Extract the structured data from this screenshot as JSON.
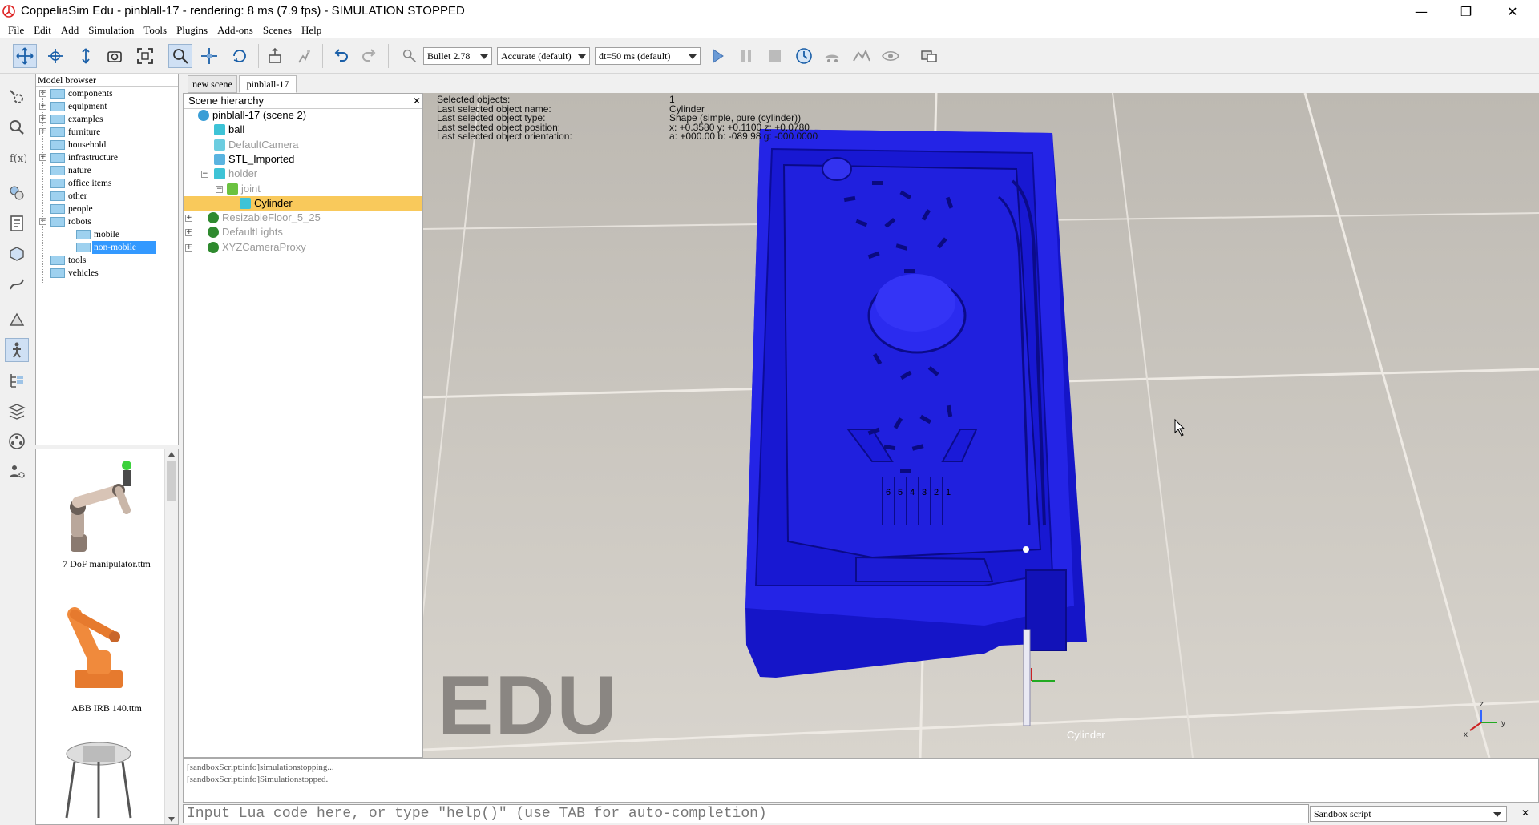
{
  "window": {
    "title": "CoppeliaSim Edu - pinblall-17 - rendering: 8 ms (7.9 fps) - SIMULATION STOPPED",
    "minimize": "—",
    "restore": "❐",
    "close": "✕"
  },
  "menu": [
    "File",
    "Edit",
    "Add",
    "Simulation",
    "Tools",
    "Plugins",
    "Add-ons",
    "Scenes",
    "Help"
  ],
  "toolbar": {
    "engine": "Bullet 2.78",
    "accuracy": "Accurate (default)",
    "timestep": "dt=50 ms (default)"
  },
  "model_browser": {
    "title": "Model browser",
    "items": [
      {
        "label": "components",
        "expandable": true,
        "level": 0
      },
      {
        "label": "equipment",
        "expandable": true,
        "level": 0
      },
      {
        "label": "examples",
        "expandable": true,
        "level": 0
      },
      {
        "label": "furniture",
        "expandable": true,
        "level": 0
      },
      {
        "label": "household",
        "expandable": false,
        "level": 0
      },
      {
        "label": "infrastructure",
        "expandable": true,
        "level": 0
      },
      {
        "label": "nature",
        "expandable": false,
        "level": 0
      },
      {
        "label": "office items",
        "expandable": false,
        "level": 0
      },
      {
        "label": "other",
        "expandable": false,
        "level": 0
      },
      {
        "label": "people",
        "expandable": false,
        "level": 0
      },
      {
        "label": "robots",
        "expandable": true,
        "level": 0
      },
      {
        "label": "mobile",
        "expandable": false,
        "level": 1
      },
      {
        "label": "non-mobile",
        "expandable": false,
        "level": 1,
        "selected": true
      },
      {
        "label": "tools",
        "expandable": false,
        "level": 0
      },
      {
        "label": "vehicles",
        "expandable": false,
        "level": 0
      }
    ],
    "thumbnails": [
      "7 DoF manipulator.ttm",
      "ABB IRB 140.ttm"
    ]
  },
  "scene_tabs": [
    "new scene",
    "pinblall-17"
  ],
  "scene_hierarchy": {
    "title": "Scene hierarchy",
    "items": [
      {
        "label": "pinblall-17 (scene 2)",
        "dim": false,
        "selected": false
      },
      {
        "label": "ball",
        "dim": false,
        "selected": false
      },
      {
        "label": "DefaultCamera",
        "dim": true,
        "selected": false
      },
      {
        "label": "STL_Imported",
        "dim": false,
        "selected": false
      },
      {
        "label": "holder",
        "dim": true,
        "selected": false
      },
      {
        "label": "joint",
        "dim": true,
        "selected": false
      },
      {
        "label": "Cylinder",
        "dim": false,
        "selected": true
      },
      {
        "label": "ResizableFloor_5_25",
        "dim": true,
        "selected": false
      },
      {
        "label": "DefaultLights",
        "dim": true,
        "selected": false
      },
      {
        "label": "XYZCameraProxy",
        "dim": true,
        "selected": false
      }
    ]
  },
  "selection_info": {
    "rows": [
      {
        "label": "Selected objects:",
        "value": "1"
      },
      {
        "label": "Last selected object name:",
        "value": "Cylinder"
      },
      {
        "label": "Last selected object type:",
        "value": "Shape (simple, pure (cylinder))"
      },
      {
        "label": "Last selected object position:",
        "value": "x: +0.3580    y: +0.1100    z: +0.0780"
      },
      {
        "label": "Last selected object orientation:",
        "value": "a: +000.00    b: -089.98    g: -000.0000"
      }
    ]
  },
  "viewport": {
    "watermark": "EDU",
    "object_label": "Cylinder",
    "board_color": "#1f1fe0",
    "axis_x": "x",
    "axis_y": "y",
    "axis_z": "z",
    "lane_numbers": [
      "6",
      "5",
      "4",
      "3",
      "2",
      "1"
    ]
  },
  "console": {
    "lines": [
      "[sandboxScript:info]simulationstopping...",
      "[sandboxScript:info]Simulationstopped."
    ]
  },
  "lua_input": {
    "placeholder": "Input Lua code here, or type \"help()\" (use TAB for auto-completion)"
  },
  "script_selector": "Sandbox script"
}
